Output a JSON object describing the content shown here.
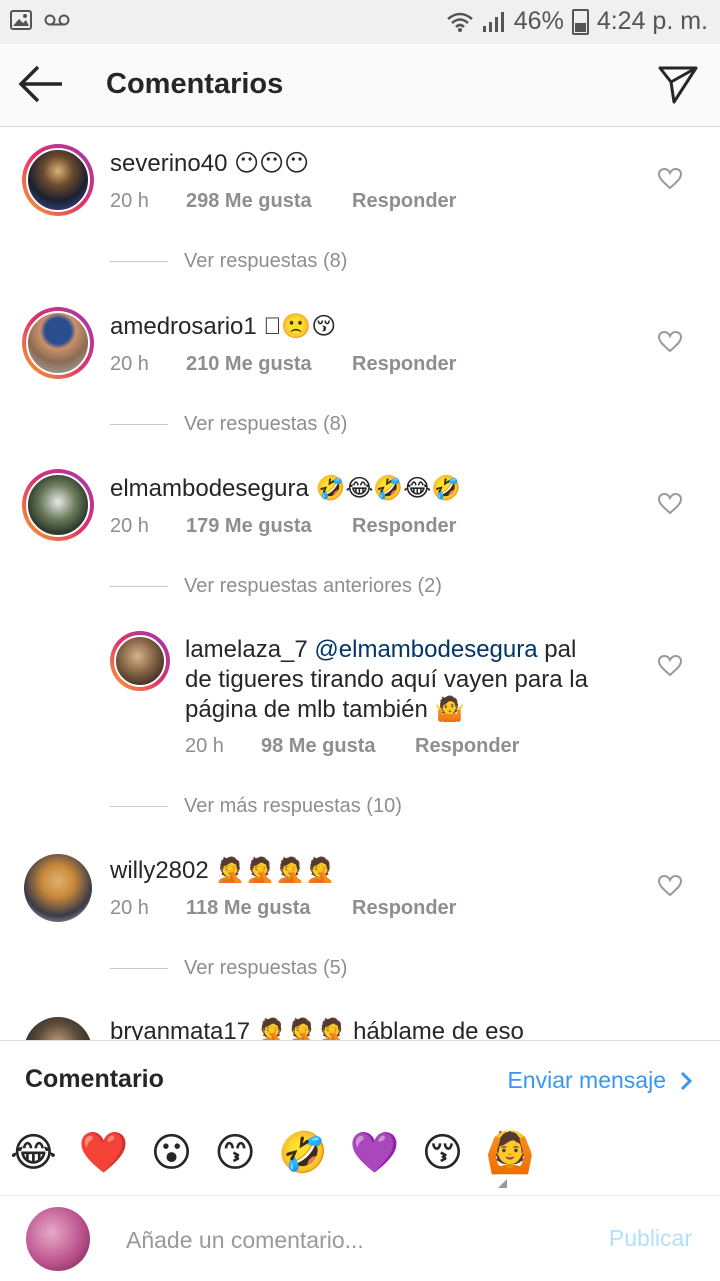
{
  "status_bar": {
    "battery": "46%",
    "time": "4:24 p. m."
  },
  "header": {
    "title": "Comentarios"
  },
  "comments": [
    {
      "username": "severino40",
      "text": "😶😶😶",
      "time": "20 h",
      "likes": "298 Me gusta",
      "reply": "Responder",
      "view_replies": "Ver respuestas (8)"
    },
    {
      "username": "amedrosario1",
      "text": "􀀀🙁😚",
      "time": "20 h",
      "likes": "210 Me gusta",
      "reply": "Responder",
      "view_replies": "Ver respuestas (8)"
    },
    {
      "username": "elmambodesegura",
      "text": "🤣😂🤣😂🤣",
      "time": "20 h",
      "likes": "179 Me gusta",
      "reply": "Responder",
      "view_replies": "Ver respuestas anteriores (2)"
    },
    {
      "username": "willy2802",
      "text": "🤦🤦🤦🤦",
      "time": "20 h",
      "likes": "118 Me gusta",
      "reply": "Responder",
      "view_replies": "Ver respuestas (5)"
    },
    {
      "username": "bryanmata17",
      "text": "🤦🤦🤦 háblame de eso"
    }
  ],
  "nested_reply": {
    "username": "lamelaza_7",
    "mention": "@elmambodesegura",
    "line1_tail": "pal",
    "line2": "de tigueres tirando aquí vayen para la",
    "line3": "página de mlb también 🤷",
    "time": "20 h",
    "likes": "98 Me gusta",
    "reply": "Responder",
    "more_replies": "Ver más respuestas (10)"
  },
  "comment_panel": {
    "title": "Comentario",
    "send_message": "Enviar mensaje",
    "emojis": [
      "😂",
      "❤️",
      "😮",
      "😙",
      "🤣",
      "💜",
      "😚",
      "🙆"
    ],
    "input_placeholder": "Añade un comentario...",
    "publish": "Publicar"
  }
}
